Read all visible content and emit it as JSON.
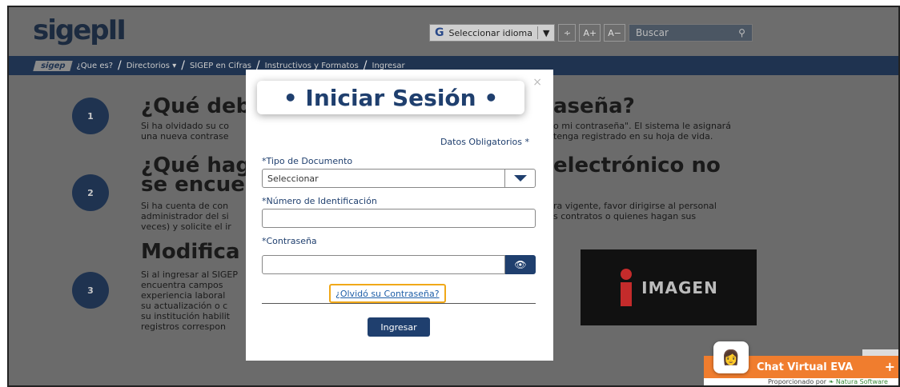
{
  "header": {
    "logo": "sigep",
    "logo_suffix": "II",
    "lang_g": "G",
    "lang_label": "Seleccionar idioma",
    "lang_caret": "▼",
    "rss": "RSS",
    "font_up": "A+",
    "font_down": "A−",
    "search_placeholder": "Buscar",
    "search_icon": "⚲"
  },
  "nav": {
    "logo": "sigep",
    "items": [
      "¿Que es?",
      "Directorios ▾",
      "SIGEP en Cifras",
      "Instructivos y Formatos",
      "Ingresar"
    ]
  },
  "content": {
    "steps": [
      "1",
      "2",
      "3"
    ],
    "h1": "¿Qué deb",
    "h1_right": "aseña?",
    "p1a": "Si ha olvidado su co",
    "p1b": "una nueva contrase",
    "p1a_right": "o mi contraseña\". El sistema le asignará",
    "p1b_right": "tenga registrado en su hoja de vida.",
    "h2a": "¿Qué hag",
    "h2b": "se encue",
    "h2_right": "electrónico no",
    "p2a": "Si ha cuenta de con",
    "p2b": "administrador del si",
    "p2c": "veces) y solicite el ir",
    "p2a_right": "ra vigente, favor dirigirse al personal",
    "p2b_right": "s contratos o quienes hagan sus",
    "h3": "Modifica",
    "p3": [
      "Si al ingresar al SIGEP",
      "encuentra campos",
      "experiencia laboral",
      "su actualización o c",
      "su institución habilit",
      "registros correspon"
    ],
    "image_label": "IMAGEN"
  },
  "modal": {
    "close": "×",
    "title": "• Iniciar Sesión •",
    "required_note": "Datos Obligatorios *",
    "doc_type_label": "*Tipo de Documento",
    "doc_type_value": "Seleccionar",
    "id_label": "*Número de Identificación",
    "id_value": "",
    "password_label": "*Contraseña",
    "eye_icon": "👁",
    "forgot": "¿Olvidó su Contraseña?",
    "submit": "Ingresar"
  },
  "chat": {
    "avatar": "👩",
    "title": "Chat Virtual EVA",
    "plus": "+",
    "footer_prefix": "Proporcionado por",
    "footer_brand": "Natura Software"
  }
}
